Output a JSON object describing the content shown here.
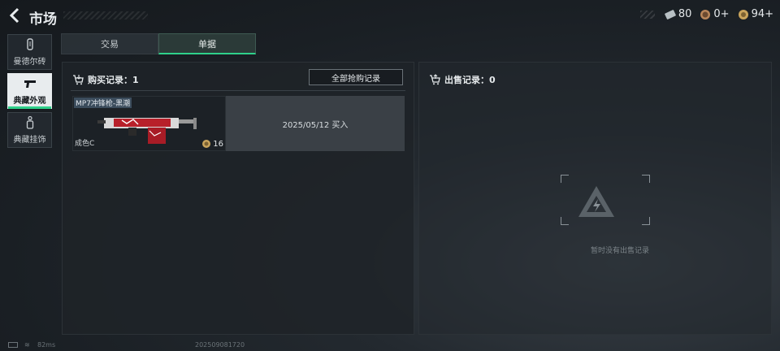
{
  "header": {
    "title": "市场"
  },
  "currencies": [
    {
      "icon": "ticket-icon",
      "value": "80"
    },
    {
      "icon": "coin-icon",
      "value": "0+"
    },
    {
      "icon": "medal-icon",
      "value": "94+"
    }
  ],
  "sidebar": {
    "items": [
      {
        "label": "曼德尔砖",
        "icon": "brick-icon",
        "active": false
      },
      {
        "label": "典藏外观",
        "icon": "pistol-icon",
        "active": true
      },
      {
        "label": "典藏挂饰",
        "icon": "charm-icon",
        "active": false
      }
    ]
  },
  "tabs": [
    {
      "label": "交易",
      "active": false
    },
    {
      "label": "单据",
      "active": true
    }
  ],
  "purchase": {
    "header": "购买记录：1",
    "all_button": "全部抢购记录",
    "records": [
      {
        "name": "MP7冲锋枪-黑潮",
        "grade": "成色C",
        "qty": "16",
        "info": "2025/05/12 买入"
      }
    ]
  },
  "sales": {
    "header": "出售记录：0",
    "empty_text": "暂时没有出售记录"
  },
  "status": {
    "ping": "82ms",
    "build": "202509081720"
  },
  "colors": {
    "accent": "#2fd08a",
    "bg": "#1a1f24"
  }
}
